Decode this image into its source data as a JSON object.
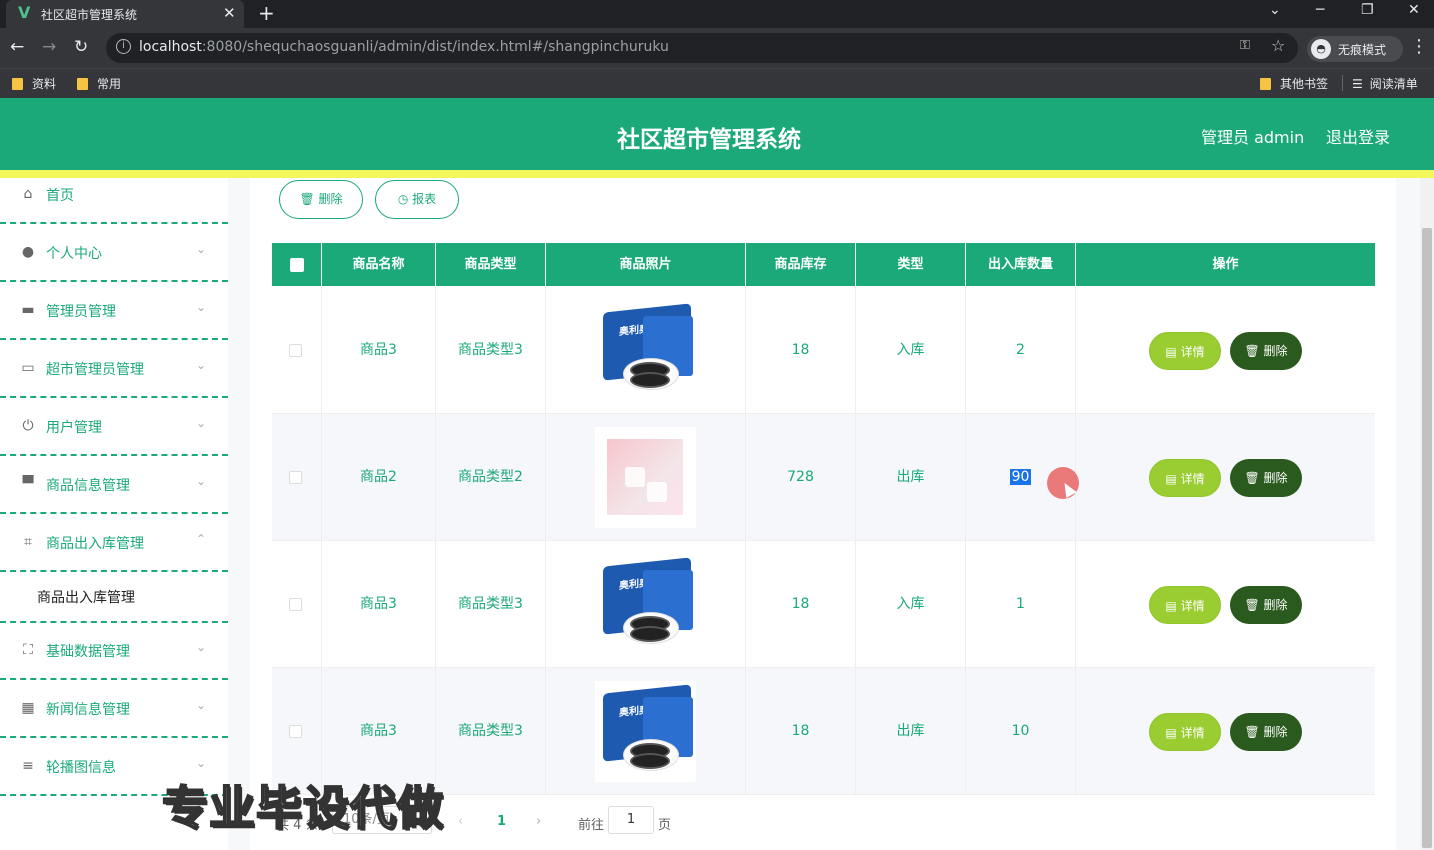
{
  "browser": {
    "tab_title": "社区超市管理系统",
    "url_host": "localhost",
    "url_path": ":8080/shequchaosguanli/admin/dist/index.html#/shangpinchuruku",
    "incognito_label": "无痕模式",
    "bookmarks": [
      "资料",
      "常用"
    ],
    "bookmarks_right": [
      "其他书签",
      "阅读清单"
    ]
  },
  "header": {
    "title": "社区超市管理系统",
    "user": "管理员 admin",
    "logout": "退出登录"
  },
  "sidebar": {
    "items": [
      {
        "label": "首页",
        "icon": "home-icon"
      },
      {
        "label": "个人中心",
        "icon": "user-icon"
      },
      {
        "label": "管理员管理",
        "icon": "monitor-icon"
      },
      {
        "label": "超市管理员管理",
        "icon": "card-icon"
      },
      {
        "label": "用户管理",
        "icon": "power-icon"
      },
      {
        "label": "商品信息管理",
        "icon": "stand-icon"
      },
      {
        "label": "商品出入库管理",
        "icon": "crop-icon"
      },
      {
        "label": "基础数据管理",
        "icon": "frame-icon"
      },
      {
        "label": "新闻信息管理",
        "icon": "grid-icon"
      },
      {
        "label": "轮播图信息",
        "icon": "menu-icon"
      }
    ],
    "subitem": "商品出入库管理"
  },
  "toolbar": {
    "delete_label": "删除",
    "report_label": "报表"
  },
  "table": {
    "columns": [
      "商品名称",
      "商品类型",
      "商品照片",
      "商品库存",
      "类型",
      "出入库数量",
      "操作"
    ],
    "rows": [
      {
        "name": "商品3",
        "type": "商品类型3",
        "photo": "oreo",
        "stock": "18",
        "kind": "入库",
        "qty": "2"
      },
      {
        "name": "商品2",
        "type": "商品类型2",
        "photo": "pink",
        "stock": "728",
        "kind": "出库",
        "qty": "90"
      },
      {
        "name": "商品3",
        "type": "商品类型3",
        "photo": "oreo",
        "stock": "18",
        "kind": "入库",
        "qty": "1"
      },
      {
        "name": "商品3",
        "type": "商品类型3",
        "photo": "oreo",
        "stock": "18",
        "kind": "出库",
        "qty": "10"
      }
    ],
    "detail_label": "详情",
    "delete_label": "删除",
    "oreo_text": "奥利奥"
  },
  "pagination": {
    "total": "共 4 条",
    "page_size": "10条/页",
    "current": "1",
    "goto_label": "前往",
    "goto_value": "1",
    "page_unit": "页"
  },
  "watermark": "专业毕设代做",
  "colors": {
    "primary": "#1ba97a",
    "stripe": "#f4f75a",
    "detail": "#9acd32",
    "delete": "#2a5a1e"
  }
}
